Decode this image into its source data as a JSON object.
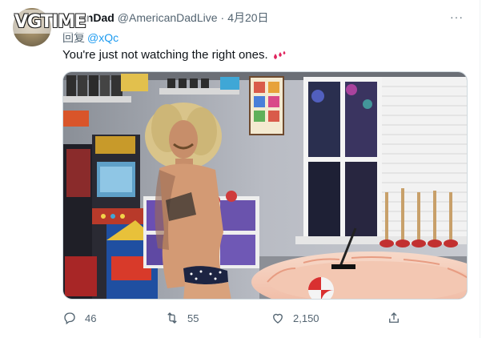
{
  "watermark": {
    "text": "VGTIME"
  },
  "tweet": {
    "display_name": "AmericanDad",
    "display_name_visible": "anDad",
    "handle": "@AmericanDadLive",
    "separator": "·",
    "date": "4月20日",
    "more_label": "···",
    "reply_prefix": "回复",
    "reply_to": "@xQc",
    "text": "You're just not watching the right ones.",
    "emoji": "droplets-emoji",
    "media_alt": "Photo of a person in a game room with arcade cabinets and an inflatable pool"
  },
  "actions": {
    "reply_count": "46",
    "retweet_count": "55",
    "like_count": "2,150"
  },
  "icons": {
    "reply": "reply-icon",
    "retweet": "retweet-icon",
    "like": "heart-icon",
    "share": "share-icon",
    "more": "more-icon"
  },
  "colors": {
    "text": "#0f1419",
    "secondary": "#536471",
    "link": "#1d9bf0",
    "emoji_red": "#e0245e"
  }
}
